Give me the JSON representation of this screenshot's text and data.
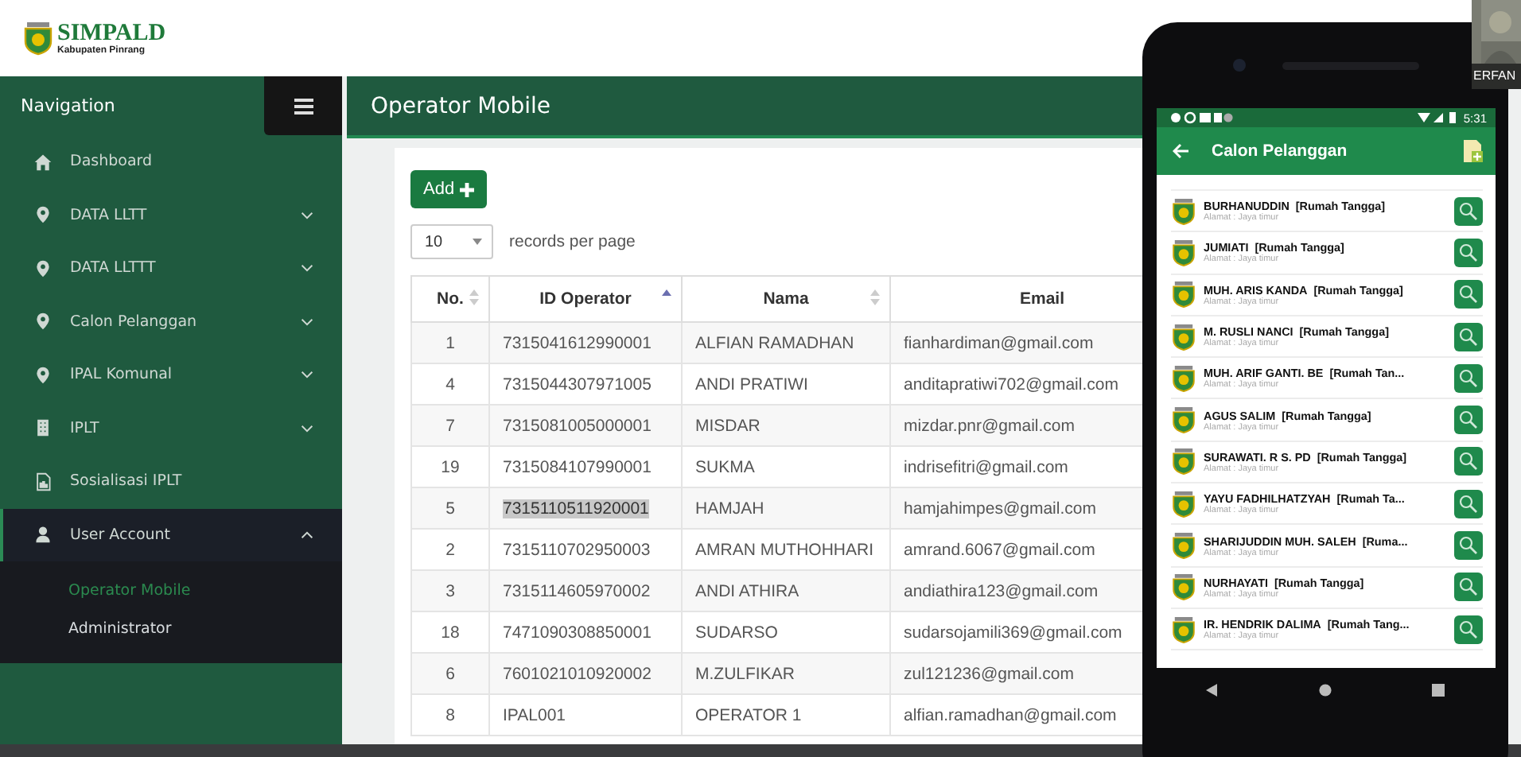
{
  "header": {
    "brand": "SIMPALD",
    "subtitle": "Kabupaten Pinrang"
  },
  "sidebar": {
    "title": "Navigation",
    "items": [
      {
        "label": "Dashboard",
        "kind": "link"
      },
      {
        "label": "DATA LLTT",
        "kind": "group",
        "expanded": false
      },
      {
        "label": "DATA LLTTT",
        "kind": "group",
        "expanded": false
      },
      {
        "label": "Calon Pelanggan",
        "kind": "group",
        "expanded": false
      },
      {
        "label": "IPAL Komunal",
        "kind": "group",
        "expanded": false
      },
      {
        "label": "IPLT",
        "kind": "group",
        "expanded": false
      },
      {
        "label": "Sosialisasi IPLT",
        "kind": "link"
      },
      {
        "label": "User Account",
        "kind": "group",
        "expanded": true,
        "children": [
          {
            "label": "Operator Mobile",
            "selected": true
          },
          {
            "label": "Administrator",
            "selected": false
          }
        ]
      }
    ]
  },
  "page_title": "Operator Mobile",
  "add_button": "Add",
  "page_size": {
    "value": "10",
    "label": "records per page"
  },
  "table": {
    "columns": [
      {
        "label": "No.",
        "sorted": false
      },
      {
        "label": "ID Operator",
        "sorted": true
      },
      {
        "label": "Nama",
        "sorted": false
      },
      {
        "label": "Email"
      }
    ],
    "rows": [
      {
        "no": "1",
        "id": "7315041612990001",
        "nama": "ALFIAN RAMADHAN",
        "email": "fianhardiman@gmail.com",
        "highlighted": false
      },
      {
        "no": "4",
        "id": "7315044307971005",
        "nama": "ANDI PRATIWI",
        "email": "anditapratiwi702@gmail.com",
        "highlighted": false
      },
      {
        "no": "7",
        "id": "7315081005000001",
        "nama": "MISDAR",
        "email": "mizdar.pnr@gmail.com",
        "highlighted": false
      },
      {
        "no": "19",
        "id": "7315084107990001",
        "nama": "SUKMA",
        "email": "indrisefitri@gmail.com",
        "highlighted": false
      },
      {
        "no": "5",
        "id": "7315110511920001",
        "nama": "HAMJAH",
        "email": "hamjahimpes@gmail.com",
        "highlighted": true
      },
      {
        "no": "2",
        "id": "7315110702950003",
        "nama": "AMRAN MUTHOHHARI",
        "email": "amrand.6067@gmail.com",
        "highlighted": false
      },
      {
        "no": "3",
        "id": "7315114605970002",
        "nama": "ANDI ATHIRA",
        "email": "andiathira123@gmail.com",
        "highlighted": false
      },
      {
        "no": "18",
        "id": "7471090308850001",
        "nama": "SUDARSO",
        "email": "sudarsojamili369@gmail.com",
        "highlighted": false
      },
      {
        "no": "6",
        "id": "7601021010920002",
        "nama": "M.ZULFIKAR",
        "email": "zul121236@gmail.com",
        "highlighted": false
      },
      {
        "no": "8",
        "id": "IPAL001",
        "nama": "OPERATOR 1",
        "email": "alfian.ramadhan@gmail.com",
        "highlighted": false
      }
    ]
  },
  "phone": {
    "time": "5:31",
    "title": "Calon Pelanggan",
    "items": [
      {
        "name": "BURHANUDDIN",
        "category": "[Rumah Tangga]",
        "address": "Alamat : Jaya timur"
      },
      {
        "name": "JUMIATI",
        "category": "[Rumah Tangga]",
        "address": "Alamat : Jaya timur"
      },
      {
        "name": "MUH. ARIS KANDA",
        "category": "[Rumah Tangga]",
        "address": "Alamat : Jaya timur"
      },
      {
        "name": "M. RUSLI NANCI",
        "category": "[Rumah Tangga]",
        "address": "Alamat : Jaya timur"
      },
      {
        "name": "MUH. ARIF GANTI. BE",
        "category": "[Rumah Tan...",
        "address": "Alamat : Jaya timur"
      },
      {
        "name": "AGUS SALIM",
        "category": "[Rumah Tangga]",
        "address": "Alamat : Jaya timur"
      },
      {
        "name": "SURAWATI. R S. PD",
        "category": "[Rumah Tangga]",
        "address": "Alamat : Jaya timur"
      },
      {
        "name": "YAYU FADHILHATZYAH",
        "category": "[Rumah Ta...",
        "address": "Alamat : Jaya timur"
      },
      {
        "name": "SHARIJUDDIN MUH. SALEH",
        "category": "[Ruma...",
        "address": "Alamat : Jaya timur"
      },
      {
        "name": "NURHAYATI",
        "category": "[Rumah Tangga]",
        "address": "Alamat : Jaya timur"
      },
      {
        "name": "IR. HENDRIK DALIMA",
        "category": "[Rumah Tang...",
        "address": "Alamat : Jaya timur"
      }
    ]
  },
  "participant": {
    "name": "ERFAN"
  }
}
